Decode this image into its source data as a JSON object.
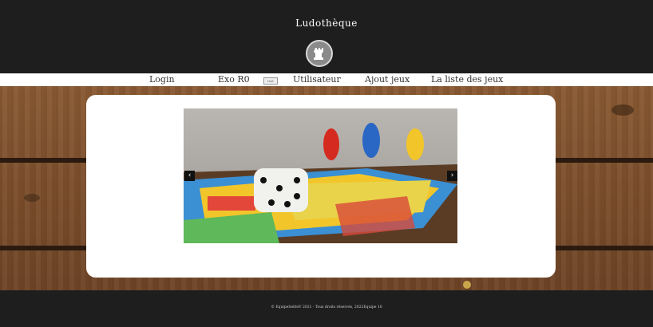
{
  "header": {
    "site_title": "Ludothèque",
    "logo_icon": "rook-icon"
  },
  "nav": {
    "items": [
      {
        "label": "Login"
      },
      {
        "label": "Exo R0"
      },
      {
        "label": "Utilisateur"
      },
      {
        "label": "Ajout jeux"
      },
      {
        "label": "La liste des jeux"
      }
    ],
    "badge_label": "test"
  },
  "carousel": {
    "prev_label": "‹",
    "next_label": "›",
    "image_desc_icon": "board-game-photo"
  },
  "footer": {
    "text": "© EquipeSelfeiV 2021 - Tous droits réservés, 2022Equipe 10"
  },
  "colors": {
    "header_bg": "#1e1e1e",
    "nav_bg": "#ffffff",
    "wood": "#7a4c2b",
    "card_bg": "#ffffff"
  }
}
